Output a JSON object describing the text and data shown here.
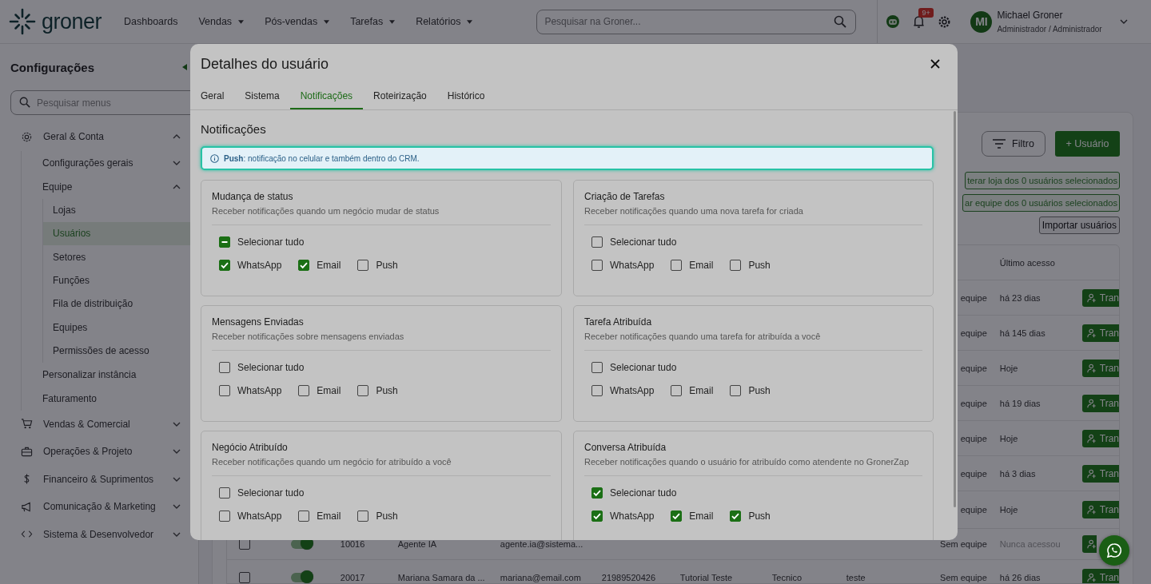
{
  "topbar": {
    "logo": "groner",
    "nav": [
      {
        "label": "Dashboards",
        "dropdown": false
      },
      {
        "label": "Vendas",
        "dropdown": true
      },
      {
        "label": "Pós-vendas",
        "dropdown": true
      },
      {
        "label": "Tarefas",
        "dropdown": true
      },
      {
        "label": "Relatórios",
        "dropdown": true
      }
    ],
    "search": {
      "placeholder": "Pesquisar na Groner..."
    },
    "notifications_badge": "9+",
    "user": {
      "initials": "MI",
      "name": "Michael Groner",
      "role": "Administrador / Administrador"
    }
  },
  "sidebar": {
    "title": "Configurações",
    "search": {
      "placeholder": "Pesquisar menus"
    },
    "items": [
      {
        "label": "Geral & Conta",
        "expanded": true,
        "children": [
          {
            "label": "Configurações gerais",
            "expanded": false
          },
          {
            "label": "Equipe",
            "expanded": true,
            "children": [
              {
                "label": "Lojas",
                "selected": false
              },
              {
                "label": "Usuários",
                "selected": true
              },
              {
                "label": "Setores",
                "selected": false
              },
              {
                "label": "Funções",
                "selected": false
              },
              {
                "label": "Fila de distribuição",
                "selected": false
              },
              {
                "label": "Equipes",
                "selected": false
              },
              {
                "label": "Permissões de acesso",
                "selected": false
              }
            ]
          },
          {
            "label": "Personalizar instância",
            "selected": false
          },
          {
            "label": "Faturamento",
            "selected": false
          }
        ]
      },
      {
        "label": "Vendas & Comercial",
        "expanded": false
      },
      {
        "label": "Operações & Projeto",
        "expanded": false
      },
      {
        "label": "Financeiro & Suprimentos",
        "expanded": false
      },
      {
        "label": "Comunicação & Marketing",
        "expanded": false
      },
      {
        "label": "Sistema & Desenvolvedor",
        "expanded": false
      }
    ]
  },
  "main": {
    "filter_button": "Filtro",
    "add_button": "+ Usuário",
    "bulk_actions": [
      "terar loja dos 0 usuários selecionados",
      "ar equipe dos 0 usuários selecionados"
    ],
    "import_button": "Importar usuários",
    "table": {
      "last_access_header": "Último acesso",
      "rows": [
        {
          "team": "equipe",
          "last_access": "há 23 dias",
          "action": "Tran"
        },
        {
          "team": "equipe",
          "last_access": "há 145 dias",
          "action": "Tran"
        },
        {
          "team": "equipe",
          "last_access": "Hoje",
          "action": "Tran"
        },
        {
          "team": "equipe",
          "last_access": "há 19 dias",
          "action": "Tran"
        },
        {
          "team": "equipe",
          "last_access": "Hoje",
          "action": "Tran"
        },
        {
          "team": "equipe",
          "last_access": "há 3 dias",
          "action": "Tran"
        },
        {
          "team": "equipe",
          "last_access": "Hoje",
          "action": "Tran"
        },
        {
          "checked": false,
          "active": true,
          "id": "10016",
          "name": "Agente IA",
          "email": "agente.ia@sistema...",
          "team": "Sem equipe",
          "last_access": "Nunca acessou",
          "never": true
        },
        {
          "checked": false,
          "active": true,
          "id": "20017",
          "name": "Mariana Samara da ...",
          "email": "mariana@email.com",
          "phone": "21989520426",
          "department": "Tutorial Teste",
          "role": "Tecnico",
          "group": "teste",
          "team": "Sem equipe",
          "last_access": "há 26 dias",
          "action": "Tran"
        }
      ]
    }
  },
  "modal": {
    "title": "Detalhes do usuário",
    "tabs": [
      {
        "label": "Geral",
        "selected": false
      },
      {
        "label": "Sistema",
        "selected": false
      },
      {
        "label": "Notificações",
        "selected": true
      },
      {
        "label": "Roteirização",
        "selected": false
      },
      {
        "label": "Histórico",
        "selected": false
      }
    ],
    "section_title": "Notificações",
    "info": "**Push**: notificação no celular e também dentro do CRM.",
    "cards": [
      {
        "title": "Mudança de status",
        "description": "Receber notificações quando um negócio mudar de status",
        "select_all": {
          "label": "Selecionar tudo",
          "checked": false,
          "indeterminate": true
        },
        "options": [
          {
            "label": "WhatsApp",
            "checked": true
          },
          {
            "label": "Email",
            "checked": true
          },
          {
            "label": "Push",
            "checked": false
          }
        ]
      },
      {
        "title": "Criação de Tarefas",
        "description": "Receber notificações quando uma nova tarefa for criada",
        "select_all": {
          "label": "Selecionar tudo",
          "checked": false,
          "indeterminate": false
        },
        "options": [
          {
            "label": "WhatsApp",
            "checked": false
          },
          {
            "label": "Email",
            "checked": false
          },
          {
            "label": "Push",
            "checked": false
          }
        ]
      },
      {
        "title": "Mensagens Enviadas",
        "description": "Receber notificações sobre mensagens enviadas",
        "select_all": {
          "label": "Selecionar tudo",
          "checked": false,
          "indeterminate": false
        },
        "options": [
          {
            "label": "WhatsApp",
            "checked": false
          },
          {
            "label": "Email",
            "checked": false
          },
          {
            "label": "Push",
            "checked": false
          }
        ]
      },
      {
        "title": "Tarefa Atribuída",
        "description": "Receber notificações quando uma tarefa for atribuída a você",
        "select_all": {
          "label": "Selecionar tudo",
          "checked": false,
          "indeterminate": false
        },
        "options": [
          {
            "label": "WhatsApp",
            "checked": false
          },
          {
            "label": "Email",
            "checked": false
          },
          {
            "label": "Push",
            "checked": false
          }
        ]
      },
      {
        "title": "Negócio Atribuído",
        "description": "Receber notificações quando um negócio for atribuído a você",
        "select_all": {
          "label": "Selecionar tudo",
          "checked": false,
          "indeterminate": false
        },
        "options": [
          {
            "label": "WhatsApp",
            "checked": false
          },
          {
            "label": "Email",
            "checked": false
          },
          {
            "label": "Push",
            "checked": false
          }
        ]
      },
      {
        "title": "Conversa Atribuída",
        "description": "Receber notificações quando o usuário for atribuído como atendente no GronerZap",
        "select_all": {
          "label": "Selecionar tudo",
          "checked": true,
          "indeterminate": false
        },
        "options": [
          {
            "label": "WhatsApp",
            "checked": true
          },
          {
            "label": "Email",
            "checked": true
          },
          {
            "label": "Push",
            "checked": true
          }
        ]
      }
    ]
  }
}
